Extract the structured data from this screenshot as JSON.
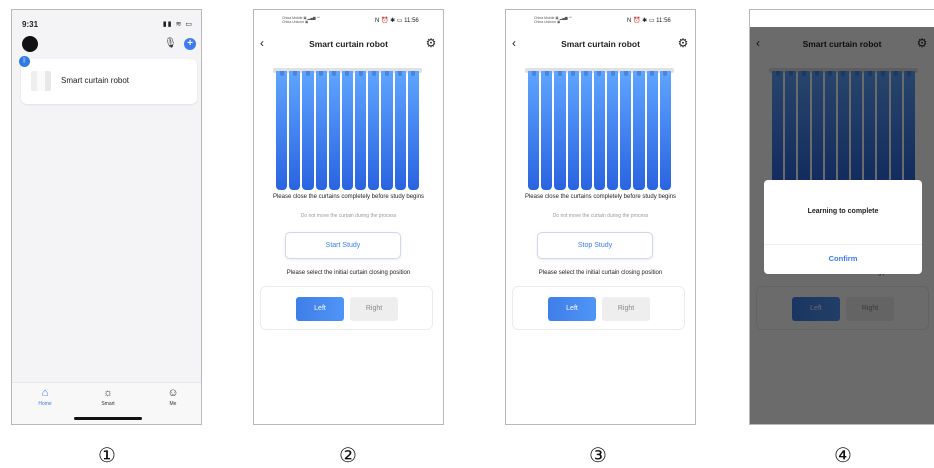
{
  "colors": {
    "accent": "#3d7cf0",
    "curtain_top": "#5fa5ff",
    "curtain_bottom": "#2a63e0"
  },
  "phone1": {
    "time": "9:31",
    "status_icons": "▮▮ ≋ ▭",
    "device_name": "Smart curtain robot",
    "tabs": [
      {
        "label": "Home",
        "icon": "home-icon"
      },
      {
        "label": "Smart",
        "icon": "sun-icon"
      },
      {
        "label": "Me",
        "icon": "user-icon"
      }
    ]
  },
  "status_bar_android": {
    "carrier_line_1": "China Mobile ▣ ▂▄▆ ⁴ᴳ",
    "carrier_line_2": "China Unicom ▣",
    "right": "N ⏰ ✱ ▭ 11:56"
  },
  "device_page": {
    "title": "Smart curtain robot",
    "hint": "Please close the curtains completely before study begins",
    "sub_hint": "Do not move the curtain during the process",
    "select_label": "Please select the initial curtain closing position",
    "left_label": "Left",
    "right_label": "Right"
  },
  "phone2": {
    "study_button": "Start Study"
  },
  "phone3": {
    "study_button": "Stop Study"
  },
  "phone4": {
    "dialog_message": "Learning to complete",
    "confirm_label": "Confirm"
  },
  "step_labels": [
    "①",
    "②",
    "③",
    "④"
  ]
}
